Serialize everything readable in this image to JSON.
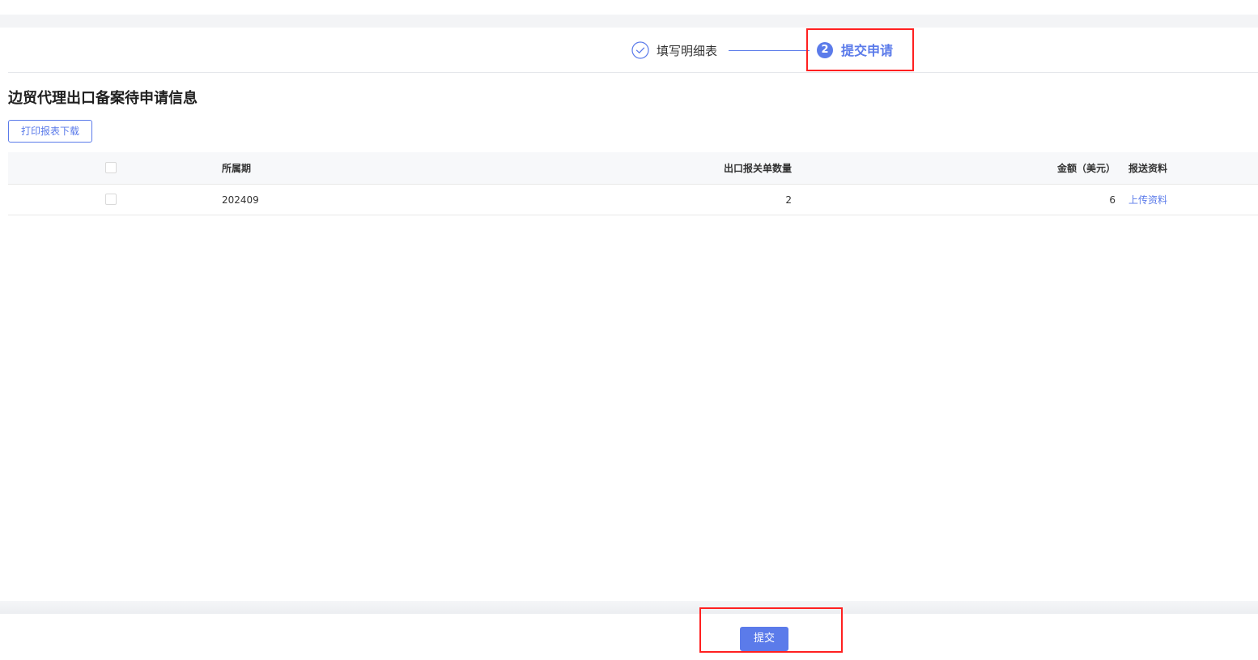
{
  "steps": [
    {
      "label": "填写明细表",
      "state": "completed"
    },
    {
      "number": "2",
      "label": "提交申请",
      "state": "active"
    }
  ],
  "page": {
    "title": "边贸代理出口备案待申请信息",
    "print_button": "打印报表下载"
  },
  "table": {
    "columns": {
      "period": "所属期",
      "count": "出口报关单数量",
      "amount": "金额（美元）",
      "docs": "报送资料"
    },
    "rows": [
      {
        "period": "202409",
        "count": "2",
        "amount": "6",
        "docs_link": "上传资料"
      }
    ]
  },
  "footer": {
    "submit_button": "提交"
  },
  "colors": {
    "accent": "#5b7bea",
    "highlight": "#ff2020"
  },
  "icons": {
    "step1": "check-circle-icon"
  }
}
